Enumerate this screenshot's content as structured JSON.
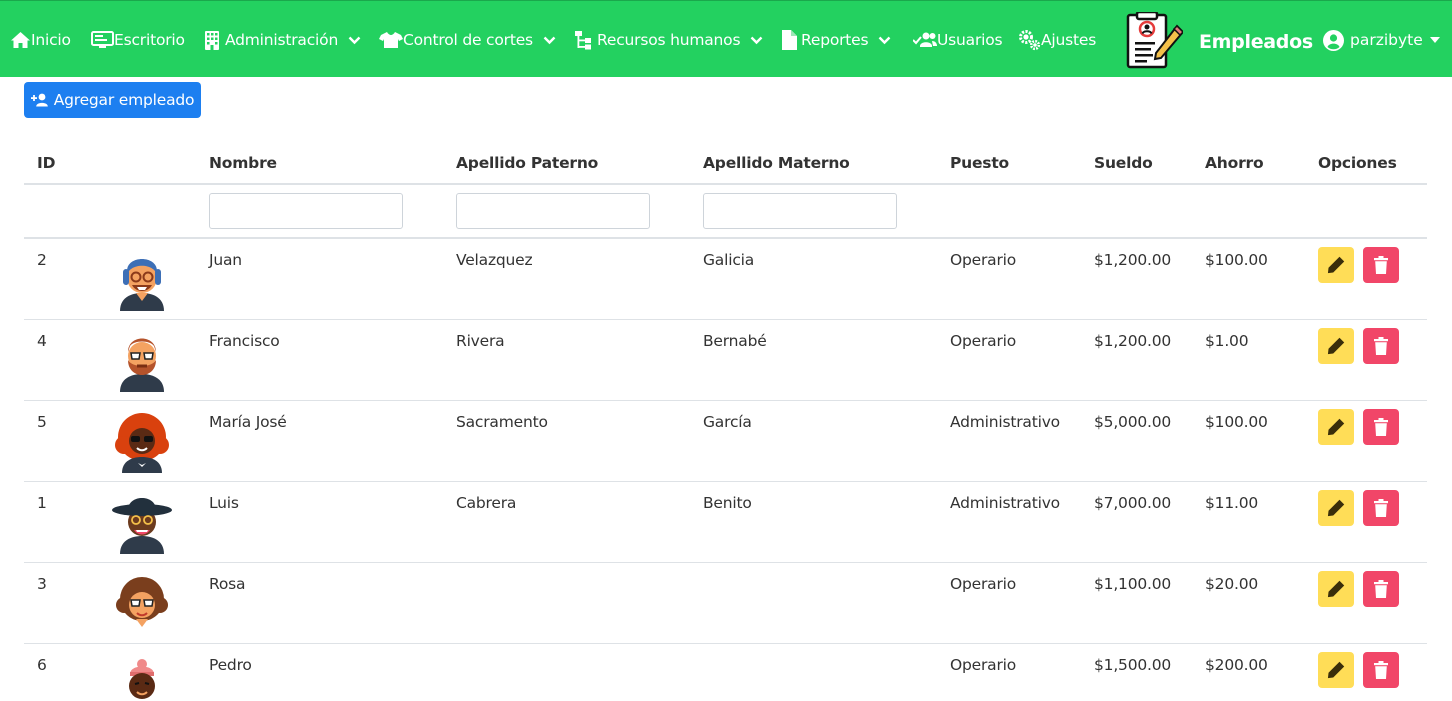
{
  "navbar": {
    "items": [
      {
        "label": "Inicio",
        "icon": "home-icon"
      },
      {
        "label": "Escritorio",
        "icon": "desktop-icon"
      },
      {
        "label": "Administración",
        "icon": "building-icon"
      },
      {
        "label": "Control de cortes",
        "icon": "shirt-icon"
      },
      {
        "label": "Recursos humanos",
        "icon": "sitemap-icon"
      },
      {
        "label": "Reportes",
        "icon": "file-icon"
      },
      {
        "label": "Usuarios",
        "icon": "users-check-icon"
      },
      {
        "label": "Ajustes",
        "icon": "cogs-icon"
      }
    ],
    "brand_title": "Empleados",
    "brand_icon": "employee-form-icon",
    "user": "parzibyte",
    "color": "#23d160"
  },
  "toolbar": {
    "add_label": "Agregar empleado",
    "add_color": "#1d7ff0"
  },
  "table": {
    "headers": [
      "ID",
      "Nombre",
      "Apellido Paterno",
      "Apellido Materno",
      "Puesto",
      "Sueldo",
      "Ahorro",
      "Opciones"
    ],
    "rows": [
      {
        "id": "2",
        "nombre": "Juan",
        "paterno": "Velazquez",
        "materno": "Galicia",
        "puesto": "Operario",
        "sueldo": "$1,200.00",
        "ahorro": "$100.00",
        "avatar": "avatar-headphones"
      },
      {
        "id": "4",
        "nombre": "Francisco",
        "paterno": "Rivera",
        "materno": "Bernabé",
        "puesto": "Operario",
        "sueldo": "$1,200.00",
        "ahorro": "$1.00",
        "avatar": "avatar-bearded-sunglasses"
      },
      {
        "id": "5",
        "nombre": "María José",
        "paterno": "Sacramento",
        "materno": "García",
        "puesto": "Administrativo",
        "sueldo": "$5,000.00",
        "ahorro": "$100.00",
        "avatar": "avatar-red-hair"
      },
      {
        "id": "1",
        "nombre": "Luis",
        "paterno": "Cabrera",
        "materno": "Benito",
        "puesto": "Administrativo",
        "sueldo": "$7,000.00",
        "ahorro": "$11.00",
        "avatar": "avatar-hat"
      },
      {
        "id": "3",
        "nombre": "Rosa",
        "paterno": "",
        "materno": "",
        "puesto": "Operario",
        "sueldo": "$1,100.00",
        "ahorro": "$20.00",
        "avatar": "avatar-curly-hair"
      },
      {
        "id": "6",
        "nombre": "Pedro",
        "paterno": "",
        "materno": "",
        "puesto": "Operario",
        "sueldo": "$1,500.00",
        "ahorro": "$200.00",
        "avatar": "avatar-beanie"
      }
    ],
    "edit_color": "#ffdd57",
    "delete_color": "#f14668"
  }
}
